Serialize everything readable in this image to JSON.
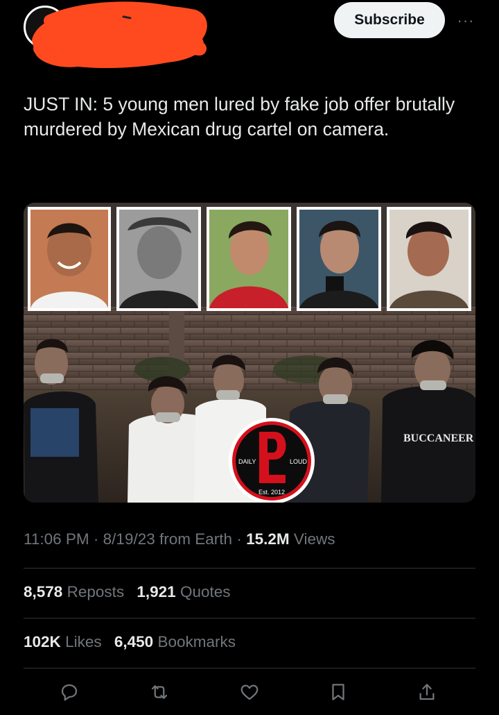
{
  "header": {
    "subscribe_label": "Subscribe",
    "more_label": "···"
  },
  "tweet": {
    "text": "JUST IN: 5 young men lured by fake job offer brutally murdered by Mexican drug cartel on camera."
  },
  "media": {
    "logo": {
      "left_text": "DAILY",
      "right_text": "LOUD",
      "bottom_text": "Est. 2012"
    },
    "shirt_text": "BUCCANEER"
  },
  "meta": {
    "time": "11:06 PM",
    "date": "8/19/23",
    "source": "from Earth",
    "separator": "·",
    "views_count": "15.2M",
    "views_label": "Views"
  },
  "stats": {
    "reposts_count": "8,578",
    "reposts_label": "Reposts",
    "quotes_count": "1,921",
    "quotes_label": "Quotes",
    "likes_count": "102K",
    "likes_label": "Likes",
    "bookmarks_count": "6,450",
    "bookmarks_label": "Bookmarks"
  },
  "actions": [
    {
      "icon": "reply-icon"
    },
    {
      "icon": "repost-icon"
    },
    {
      "icon": "like-icon"
    },
    {
      "icon": "bookmark-icon"
    },
    {
      "icon": "share-icon"
    }
  ],
  "colors": {
    "background": "#000000",
    "text": "#e7e9ea",
    "muted": "#71767b",
    "redaction": "#ff4a1f",
    "divider": "#2f3336"
  }
}
